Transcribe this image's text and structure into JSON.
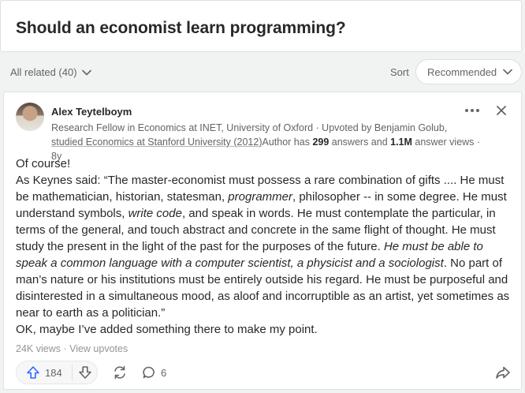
{
  "question": {
    "title": "Should an economist learn programming?"
  },
  "filter": {
    "all_related": "All related (40)",
    "sort_label": "Sort",
    "sort_value": "Recommended"
  },
  "answer": {
    "author": {
      "name": "Alex Teytelboym",
      "credential": "Research Fellow in Economics at INET, University of Oxford",
      "sep1": " · ",
      "upvoted_by": "Upvoted by Benjamin Golub, ",
      "studied": "studied Economics at Stanford University (2012)",
      "author_has": "Author has ",
      "answers_count": "299",
      "answers_and": " answers and ",
      "views_count": "1.1M",
      "answer_views": " answer views",
      "sep2": " · ",
      "age": "8y"
    },
    "body": {
      "line1": "Of course!",
      "p2_a": "As Keynes said: “The master-economist must possess a rare combination of gifts .... He must be mathematician, historian, statesman, ",
      "p2_b": "programmer",
      "p2_c": ", philosopher -- in some degree. He must understand symbols, ",
      "p2_d": "write code",
      "p2_e": ", and speak in words. He must contemplate the particular, in terms of the general, and touch abstract and concrete in the same flight of thought. He must study the present in the light of the past for the purposes of the future. ",
      "p2_f": "He must be able to speak a common language with a computer scientist, a physicist and a sociologist",
      "p2_g": ". No part of man’s nature or his institutions must be entirely outside his regard. He must be purposeful and disinterested in a simultaneous mood, as aloof and incorruptible as an artist, yet sometimes as near to earth as a politician.”",
      "line3": "OK, maybe I’ve added something there to make my point."
    },
    "stats": {
      "views": "24K views",
      "sep": " · ",
      "view_upvotes": "View upvotes"
    },
    "actions": {
      "upvotes": "184",
      "comments": "6"
    }
  },
  "icons": {
    "more": "more-horizontal-icon",
    "close": "close-icon",
    "upvote": "arrow-up-icon",
    "downvote": "arrow-down-icon",
    "share": "repost-icon",
    "comment": "comment-icon",
    "forward": "share-forward-icon",
    "chevron": "chevron-down-icon"
  },
  "colors": {
    "accent": "#2e69ff",
    "text": "#282829",
    "muted": "#636466"
  }
}
